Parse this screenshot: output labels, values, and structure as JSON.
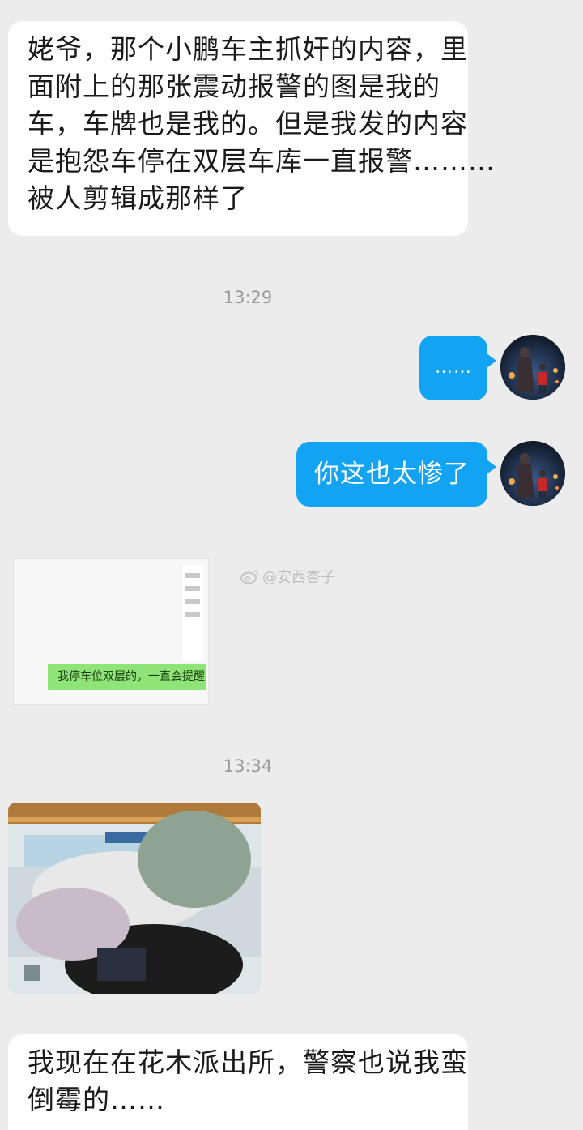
{
  "messages": {
    "first": {
      "lines": [
        "姥爷，那个小鹏车主抓奸的内容，里",
        "面附上的那张震动报警的图是我的",
        "车，车牌也是我的。但是我发的内容",
        "是抱怨车停在双层车库一直报警………",
        "被人剪辑成那样了"
      ]
    },
    "time1": "13:29",
    "reply1": "……",
    "reply2": "你这也太惨了",
    "attachment_text": "我停车位双层的，一直会提醒",
    "watermark": "@安西杏子",
    "time2": "13:34",
    "last": {
      "lines": [
        "我现在在花木派出所，警察也说我蛮",
        "倒霉的……"
      ]
    }
  },
  "colors": {
    "background": "#ececec",
    "incoming_bubble": "#ffffff",
    "outgoing_bubble": "#12a3f2",
    "attachment_bar": "#8ee476"
  },
  "icons": {
    "avatar": "avatar-silhouette-icon",
    "watermark": "weibo-logo-icon"
  }
}
